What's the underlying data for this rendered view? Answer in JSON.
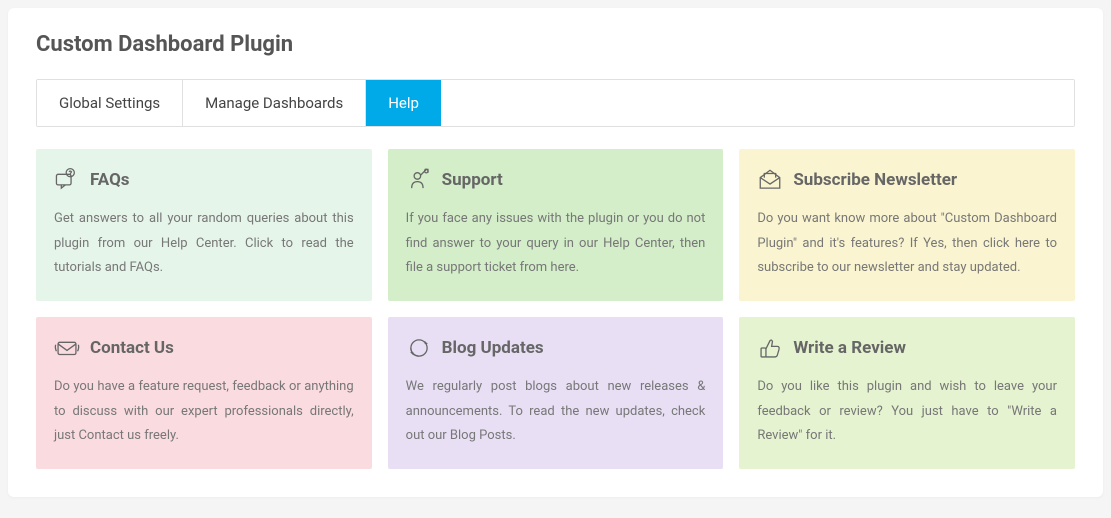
{
  "header": {
    "title": "Custom Dashboard Plugin"
  },
  "tabs": [
    {
      "label": "Global Settings",
      "active": false
    },
    {
      "label": "Manage Dashboards",
      "active": false
    },
    {
      "label": "Help",
      "active": true
    }
  ],
  "cards": [
    {
      "icon": "faq-icon",
      "title": "FAQs",
      "body": "Get answers to all your random queries about this plugin from our Help Center. Click to read the tutorials and FAQs."
    },
    {
      "icon": "support-icon",
      "title": "Support",
      "body": "If you face any issues with the plugin or you do not find answer to your query in our Help Center, then file a support ticket from here."
    },
    {
      "icon": "newsletter-icon",
      "title": "Subscribe Newsletter",
      "body": "Do you want know more about \"Custom Dashboard Plugin\" and it's features? If Yes, then click here to subscribe to our newsletter and stay updated."
    },
    {
      "icon": "contact-icon",
      "title": "Contact Us",
      "body": "Do you have a feature request, feedback or anything to discuss with our expert professionals directly, just Contact us freely."
    },
    {
      "icon": "blog-icon",
      "title": "Blog Updates",
      "body": "We regularly post blogs about new releases & announcements. To read the new updates, check out our Blog Posts."
    },
    {
      "icon": "review-icon",
      "title": "Write a Review",
      "body": "Do you like this plugin and wish to leave your feedback or review? You just have to \"Write a Review\" for it."
    }
  ]
}
